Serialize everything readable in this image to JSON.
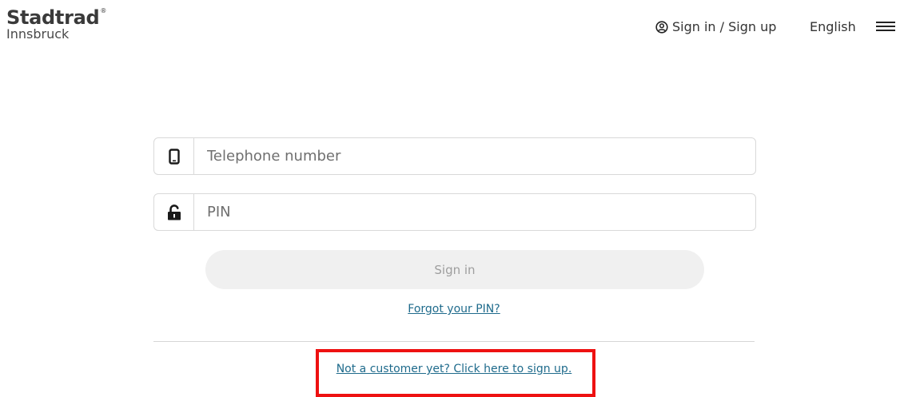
{
  "brand": {
    "name": "Stadtrad",
    "reg_mark": "®",
    "city": "Innsbruck"
  },
  "header": {
    "signin_label": "Sign in / Sign up",
    "language": "English",
    "menu_icon": "hamburger-menu-icon",
    "user_icon": "user-circle-icon"
  },
  "form": {
    "phone": {
      "placeholder": "Telephone number",
      "value": "",
      "icon": "mobile-phone-icon"
    },
    "pin": {
      "placeholder": "PIN",
      "value": "",
      "icon": "unlock-icon"
    },
    "signin_button_label": "Sign in",
    "forgot_pin_label": "Forgot your PIN?",
    "signup_label": "Not a customer yet? Click here to sign up."
  },
  "colors": {
    "link": "#1f6b8c",
    "button_bg": "#f0f0f0",
    "button_text": "#9e9e9e",
    "highlight": "#ee1111"
  }
}
